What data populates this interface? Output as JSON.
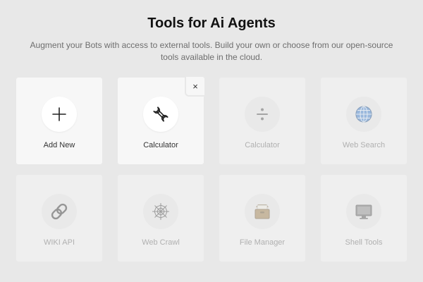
{
  "header": {
    "title": "Tools for Ai Agents",
    "subtitle": "Augment your Bots with access to external tools. Build your own or choose from our open-source tools available in the cloud."
  },
  "tools": [
    {
      "label": "Add New",
      "icon": "plus-icon",
      "state": "active"
    },
    {
      "label": "Calculator",
      "icon": "wrench-icon",
      "state": "active",
      "removable": true,
      "remove_label": "×"
    },
    {
      "label": "Calculator",
      "icon": "divide-icon",
      "state": "disabled"
    },
    {
      "label": "Web Search",
      "icon": "globe-icon",
      "state": "disabled"
    },
    {
      "label": "WIKI API",
      "icon": "link-icon",
      "state": "disabled"
    },
    {
      "label": "Web Crawl",
      "icon": "spider-web-icon",
      "state": "disabled"
    },
    {
      "label": "File Manager",
      "icon": "file-box-icon",
      "state": "disabled"
    },
    {
      "label": "Shell Tools",
      "icon": "monitor-icon",
      "state": "disabled"
    }
  ],
  "colors": {
    "background": "#e8e8e8",
    "card_active": "#f7f7f7",
    "card_disabled": "#efefef",
    "label_disabled": "#b0b0b0"
  }
}
